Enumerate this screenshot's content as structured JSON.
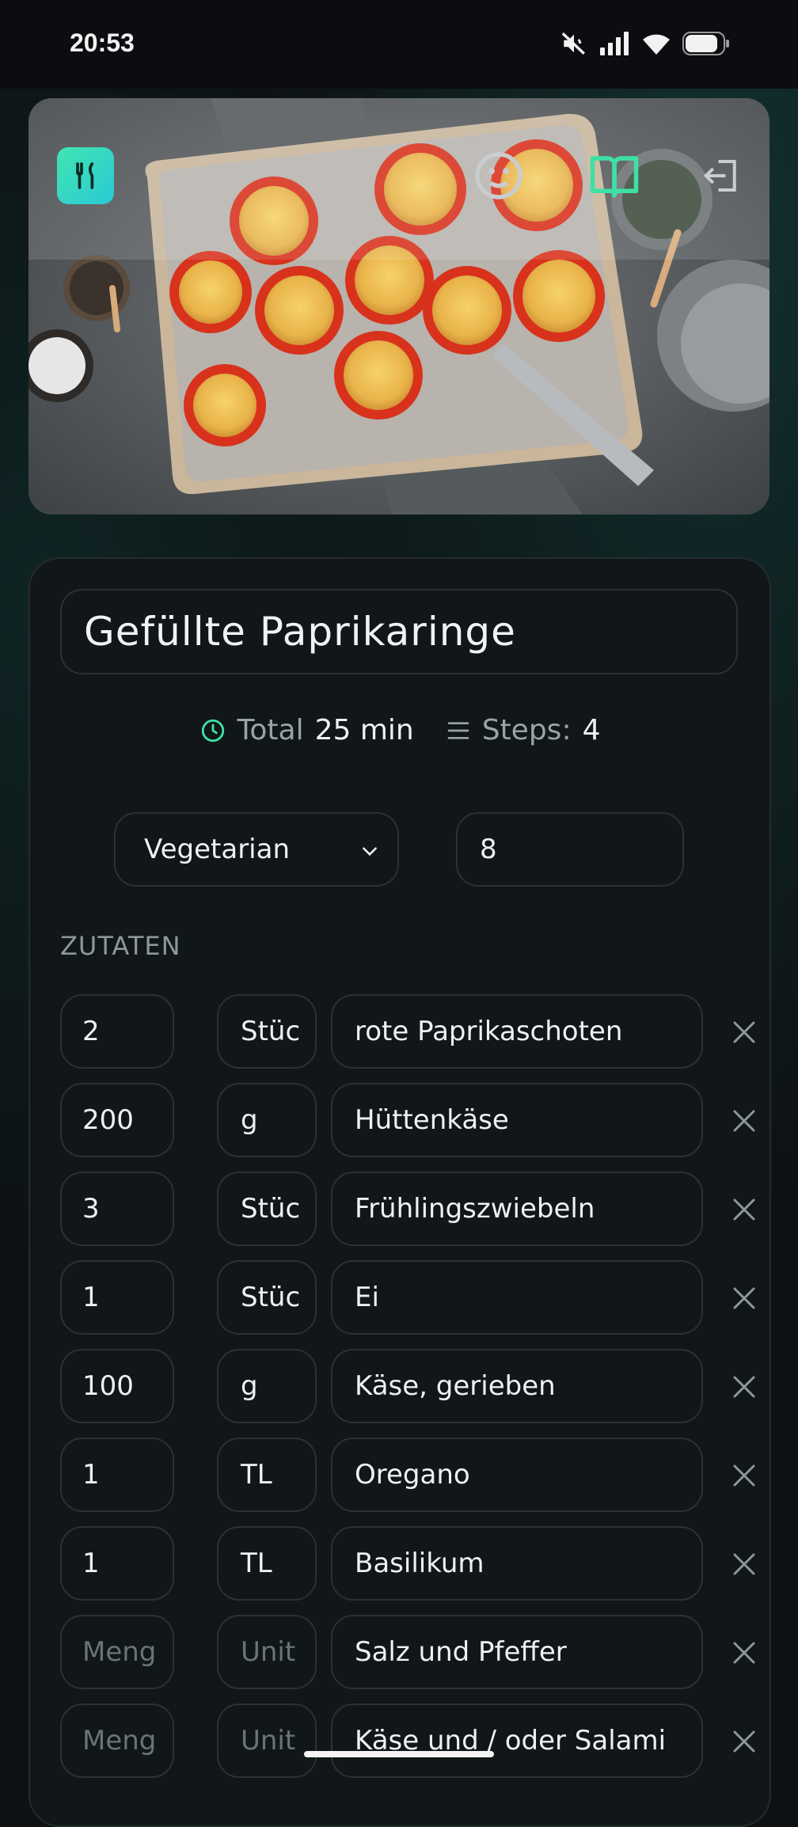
{
  "status": {
    "time": "20:53"
  },
  "recipe": {
    "title": "Gefüllte Paprikaringe",
    "total_label": "Total",
    "total_value": "25 min",
    "steps_label": "Steps:",
    "steps_value": "4",
    "diet": "Vegetarian",
    "servings": "8"
  },
  "ingredients_label": "ZUTATEN",
  "placeholders": {
    "qty": "Meng",
    "unit": "Unit"
  },
  "ingredients": [
    {
      "qty": "2",
      "unit": "Stüc",
      "name": "rote Paprikaschoten"
    },
    {
      "qty": "200",
      "unit": "g",
      "name": "Hüttenkäse"
    },
    {
      "qty": "3",
      "unit": "Stüc",
      "name": "Frühlingszwiebeln"
    },
    {
      "qty": "1",
      "unit": "Stüc",
      "name": "Ei"
    },
    {
      "qty": "100",
      "unit": "g",
      "name": "Käse, gerieben"
    },
    {
      "qty": "1",
      "unit": "TL",
      "name": "Oregano"
    },
    {
      "qty": "1",
      "unit": "TL",
      "name": "Basilikum"
    },
    {
      "qty": "",
      "unit": "",
      "name": "Salz und Pfeffer"
    },
    {
      "qty": "",
      "unit": "",
      "name": "Käse und / oder Salami"
    }
  ],
  "icons": [
    "chef-icon",
    "face-icon",
    "book-icon",
    "logout-icon",
    "clock-icon",
    "list-icon",
    "chevron-down-icon",
    "close-icon"
  ],
  "colors": {
    "accent": "#3ee0a6",
    "background": "#0d1113"
  }
}
